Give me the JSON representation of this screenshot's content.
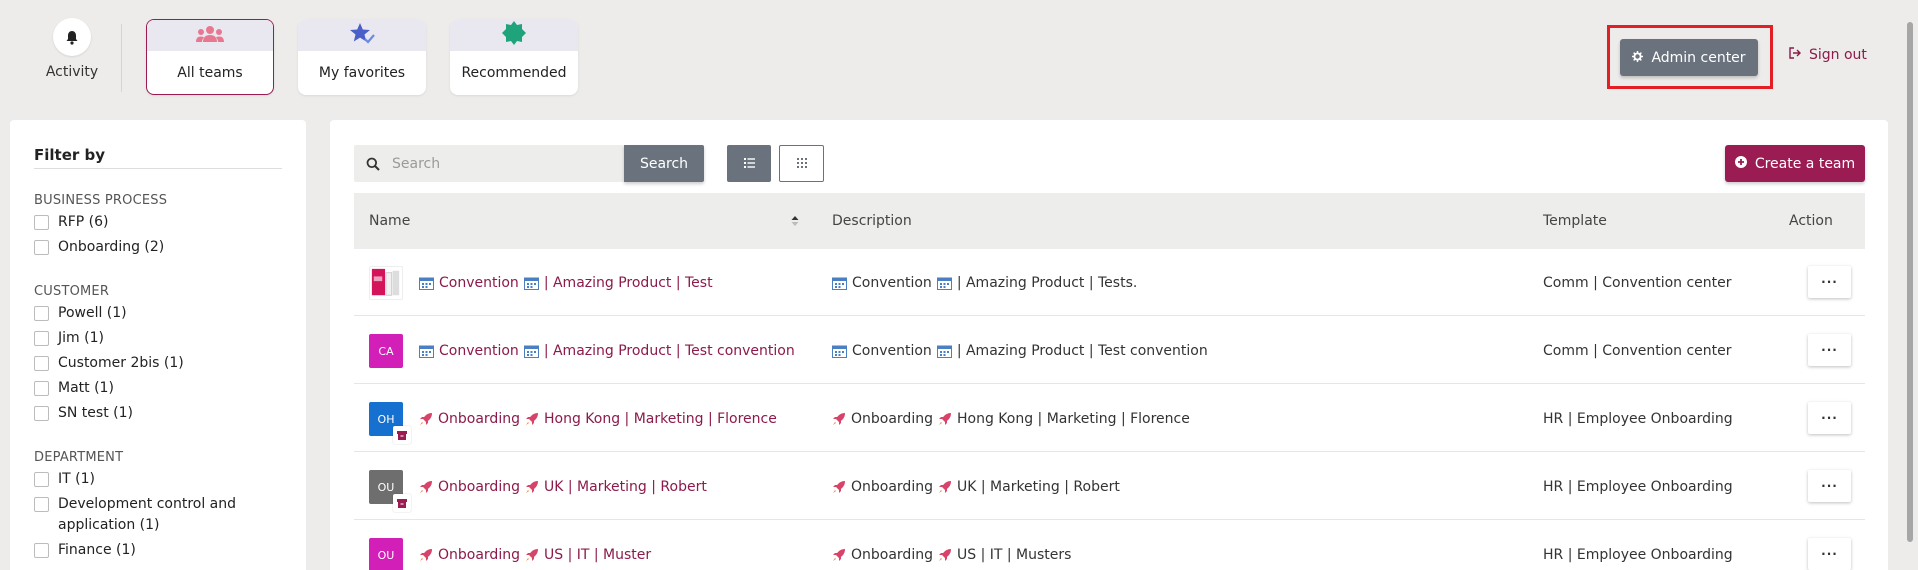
{
  "colors": {
    "brand": "#9b1c52",
    "secondary_button": "#6a737d",
    "highlight": "#e31e25"
  },
  "topbar": {
    "activity_label": "Activity",
    "tabs": [
      {
        "label": "All teams",
        "icon": "team-icon",
        "active": true
      },
      {
        "label": "My favorites",
        "icon": "star-icon",
        "active": false
      },
      {
        "label": "Recommended",
        "icon": "badge-icon",
        "active": false
      }
    ],
    "admin_center_label": "Admin center",
    "sign_out_label": "Sign out"
  },
  "sidebar": {
    "title": "Filter by",
    "groups": [
      {
        "title": "BUSINESS PROCESS",
        "options": [
          "RFP (6)",
          "Onboarding (2)"
        ]
      },
      {
        "title": "CUSTOMER",
        "options": [
          "Powell (1)",
          "Jim (1)",
          "Customer 2bis (1)",
          "Matt (1)",
          "SN test (1)"
        ]
      },
      {
        "title": "DEPARTMENT",
        "options": [
          "IT (1)",
          "Development control and application (1)",
          "Finance (1)"
        ]
      }
    ]
  },
  "toolbar": {
    "search_placeholder": "Search",
    "search_label": "Search",
    "create_label": "Create a team"
  },
  "table": {
    "headers": {
      "name": "Name",
      "description": "Description",
      "template": "Template",
      "action": "Action"
    },
    "rows": [
      {
        "avatar_text": "",
        "avatar_color": "#ffffff",
        "archived": false,
        "prefix_icon": "calendar-icon",
        "name_part1": "Convention",
        "name_part2": "| Amazing Product | Test",
        "desc_part1": "Convention",
        "desc_part2": "| Amazing Product | Tests.",
        "template": "Comm | Convention center",
        "action": "···"
      },
      {
        "avatar_text": "CA",
        "avatar_color": "#d21fb8",
        "archived": false,
        "prefix_icon": "calendar-icon",
        "name_part1": "Convention",
        "name_part2": "| Amazing Product | Test convention",
        "desc_part1": "Convention",
        "desc_part2": "| Amazing Product | Test convention",
        "template": "Comm | Convention center",
        "action": "···"
      },
      {
        "avatar_text": "OH",
        "avatar_color": "#1570d0",
        "archived": true,
        "prefix_icon": "rocket-icon",
        "name_part1": "Onboarding",
        "name_part2": "Hong Kong | Marketing | Florence",
        "desc_part1": "Onboarding",
        "desc_part2": "Hong Kong | Marketing | Florence",
        "template": "HR | Employee Onboarding",
        "action": "···"
      },
      {
        "avatar_text": "OU",
        "avatar_color": "#6e6e6e",
        "archived": true,
        "prefix_icon": "rocket-icon",
        "name_part1": "Onboarding",
        "name_part2": "UK | Marketing | Robert",
        "desc_part1": "Onboarding",
        "desc_part2": "UK | Marketing | Robert",
        "template": "HR | Employee Onboarding",
        "action": "···"
      },
      {
        "avatar_text": "OU",
        "avatar_color": "#d21fb8",
        "archived": false,
        "prefix_icon": "rocket-icon",
        "name_part1": "Onboarding",
        "name_part2": "US | IT | Muster",
        "desc_part1": "Onboarding",
        "desc_part2": "US | IT | Musters",
        "template": "HR | Employee Onboarding",
        "action": "···"
      }
    ]
  }
}
